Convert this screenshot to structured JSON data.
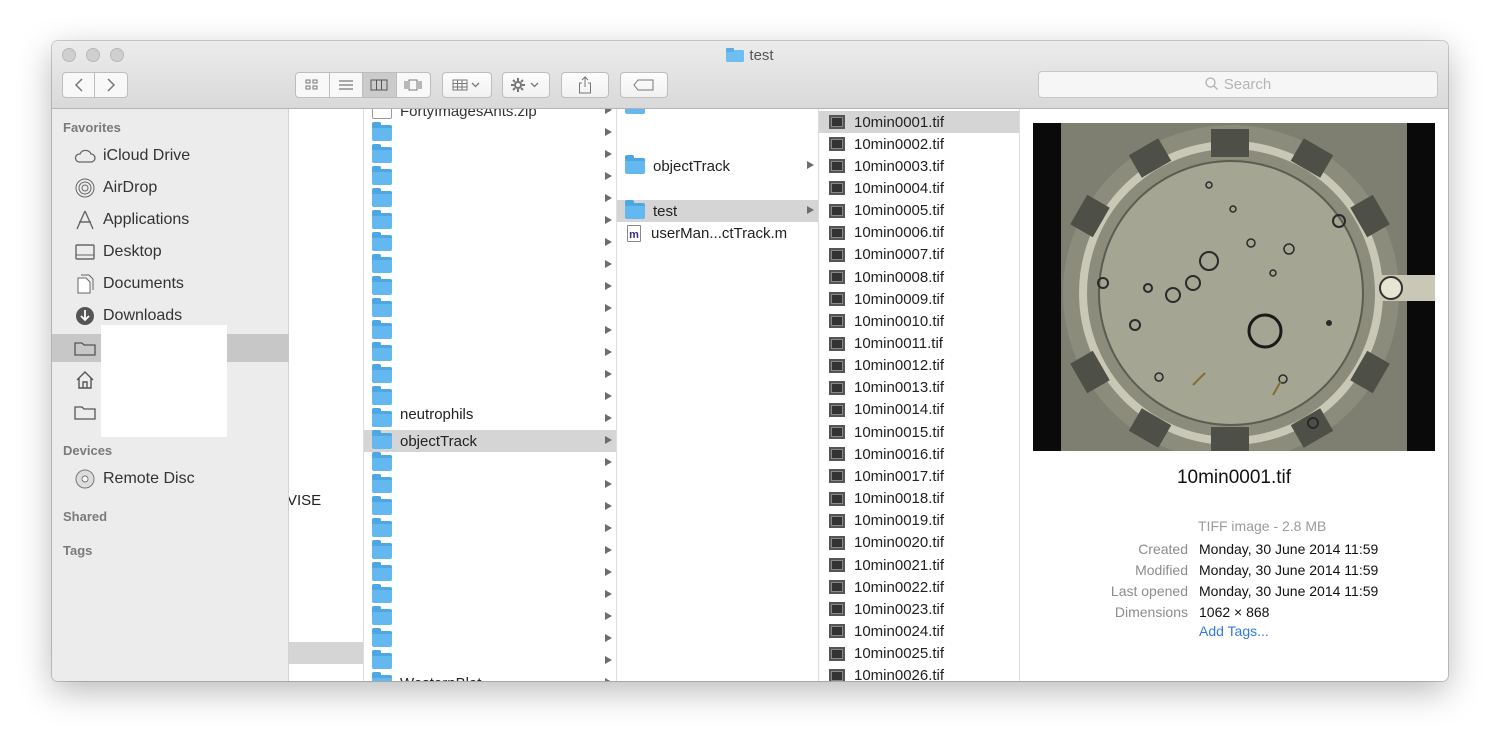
{
  "window": {
    "title": "test"
  },
  "toolbar": {
    "back": "<",
    "forward": ">",
    "search_placeholder": "Search"
  },
  "sidebar": {
    "favorites_heading": "Favorites",
    "favorites": [
      {
        "label": "iCloud Drive",
        "icon": "cloud-icon"
      },
      {
        "label": "AirDrop",
        "icon": "airdrop-icon"
      },
      {
        "label": "Applications",
        "icon": "applications-icon"
      },
      {
        "label": "Desktop",
        "icon": "desktop-icon"
      },
      {
        "label": "Documents",
        "icon": "documents-icon"
      },
      {
        "label": "Downloads",
        "icon": "downloads-icon"
      }
    ],
    "devices_heading": "Devices",
    "devices": [
      {
        "label": "Remote Disc",
        "icon": "disc-icon"
      }
    ],
    "shared_heading": "Shared",
    "tags_heading": "Tags"
  },
  "column1": {
    "partial_text": "VISE"
  },
  "column2": {
    "top_partial": "FortyImagesAnts.zip",
    "partial_label": "neutrophils",
    "selected": "objectTrack",
    "bottom_partial": "WesternBlot"
  },
  "column3": {
    "items": [
      {
        "label": "objectTrack",
        "type": "folder"
      },
      {
        "label": "test",
        "type": "folder"
      },
      {
        "label": "userMan...ctTrack.m",
        "type": "m-file"
      }
    ]
  },
  "column4": {
    "files": [
      "10min0001.tif",
      "10min0002.tif",
      "10min0003.tif",
      "10min0004.tif",
      "10min0005.tif",
      "10min0006.tif",
      "10min0007.tif",
      "10min0008.tif",
      "10min0009.tif",
      "10min0010.tif",
      "10min0011.tif",
      "10min0012.tif",
      "10min0013.tif",
      "10min0014.tif",
      "10min0015.tif",
      "10min0016.tif",
      "10min0017.tif",
      "10min0018.tif",
      "10min0019.tif",
      "10min0020.tif",
      "10min0021.tif",
      "10min0022.tif",
      "10min0023.tif",
      "10min0024.tif",
      "10min0025.tif",
      "10min0026.tif"
    ]
  },
  "preview": {
    "filename": "10min0001.tif",
    "kind": "TIFF image - 2.8 MB",
    "created_label": "Created",
    "created": "Monday, 30 June 2014 11:59",
    "modified_label": "Modified",
    "modified": "Monday, 30 June 2014 11:59",
    "opened_label": "Last opened",
    "opened": "Monday, 30 June 2014 11:59",
    "dimensions_label": "Dimensions",
    "dimensions": "1062 × 868",
    "add_tags": "Add Tags..."
  },
  "colors": {
    "accent": "#2f7ae5",
    "folder": "#63b8f0",
    "selection": "#d5d5d5"
  }
}
